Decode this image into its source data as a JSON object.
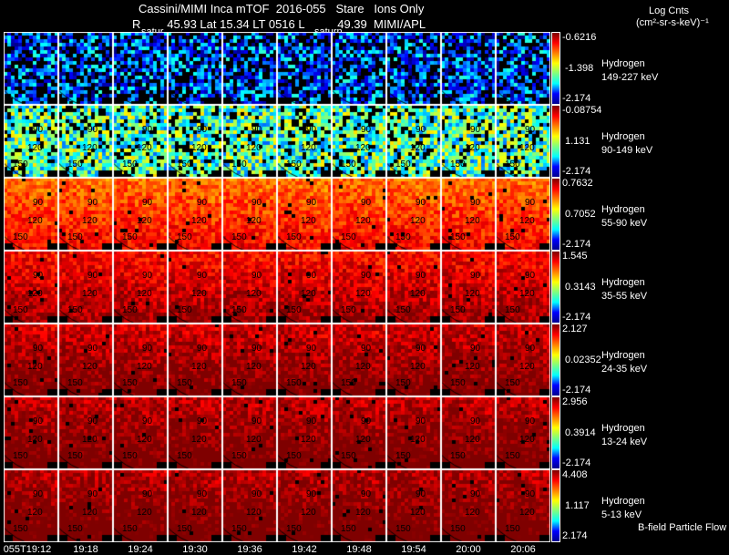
{
  "header": {
    "line1": "Cassini/MIMI Inca mTOF  2016-055   Stare   Ions Only",
    "line2": "R        45.93 Lat 15.34 LT 0516 L          49.39  MIMI/APL",
    "saturn_labels": [
      "satur",
      "saturn"
    ]
  },
  "units": {
    "line1": "Log Cnts",
    "line2": "(cm²-sr-s-keV)⁻¹"
  },
  "footer_note": "B-field Particle Flow",
  "contour_labels": [
    "90",
    "120",
    "150"
  ],
  "chart_data": {
    "type": "heatmap",
    "times": [
      "055T19:12",
      "19:18",
      "19:24",
      "19:30",
      "19:36",
      "19:42",
      "19:48",
      "19:54",
      "20:00",
      "20:06"
    ],
    "colormap": "jet",
    "rows": [
      {
        "species": "Hydrogen",
        "energy": "149-227 keV",
        "max": "-0.6216",
        "mid": "-1.398",
        "min": "-2.174",
        "level": 0.2
      },
      {
        "species": "Hydrogen",
        "energy": "90-149 keV",
        "max": "-0.08754",
        "mid": "1.131",
        "min": "-2.174",
        "level": 0.45
      },
      {
        "species": "Hydrogen",
        "energy": "55-90 keV",
        "max": "0.7632",
        "mid": "0.7052",
        "min": "-2.174",
        "level": 0.75
      },
      {
        "species": "Hydrogen",
        "energy": "35-55 keV",
        "max": "1.545",
        "mid": "0.3143",
        "min": "-2.174",
        "level": 0.85
      },
      {
        "species": "Hydrogen",
        "energy": "24-35 keV",
        "max": "2.127",
        "mid": "0.02352",
        "min": "-2.174",
        "level": 0.9
      },
      {
        "species": "Hydrogen",
        "energy": "13-24 keV",
        "max": "2.956",
        "mid": "0.3914",
        "min": "-2.174",
        "level": 0.92
      },
      {
        "species": "Hydrogen",
        "energy": "5-13 keV",
        "max": "4.408",
        "mid": "1.117",
        "min": "2.174",
        "level": 0.93
      }
    ]
  }
}
